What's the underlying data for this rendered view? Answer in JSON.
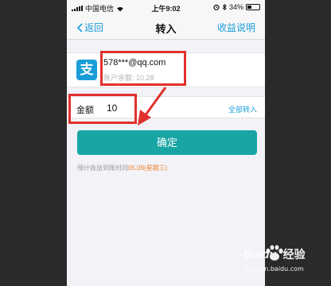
{
  "statusbar": {
    "carrier": "中国电信",
    "time": "上午9:02",
    "battery": "34%",
    "battery_level": 0.34
  },
  "navbar": {
    "back_label": "返回",
    "title": "转入",
    "right_link": "收益说明"
  },
  "account": {
    "logo_char": "支",
    "email": "578***@qq.com",
    "balance": "账户余额: 10.28"
  },
  "amount": {
    "label": "金额",
    "value": "10",
    "transfer_all": "全部转入"
  },
  "confirm_label": "确定",
  "hint": {
    "prefix": "预计收益到账时间",
    "date": "05.09(星期三)"
  },
  "watermark": {
    "brand": "Baidu",
    "jingyan": "经验",
    "url": "jingyan.baidu.com"
  },
  "colors": {
    "accent": "#1a9dd9",
    "confirm": "#1aa5a5",
    "highlight": "#e0312d",
    "date": "#f0812a"
  }
}
